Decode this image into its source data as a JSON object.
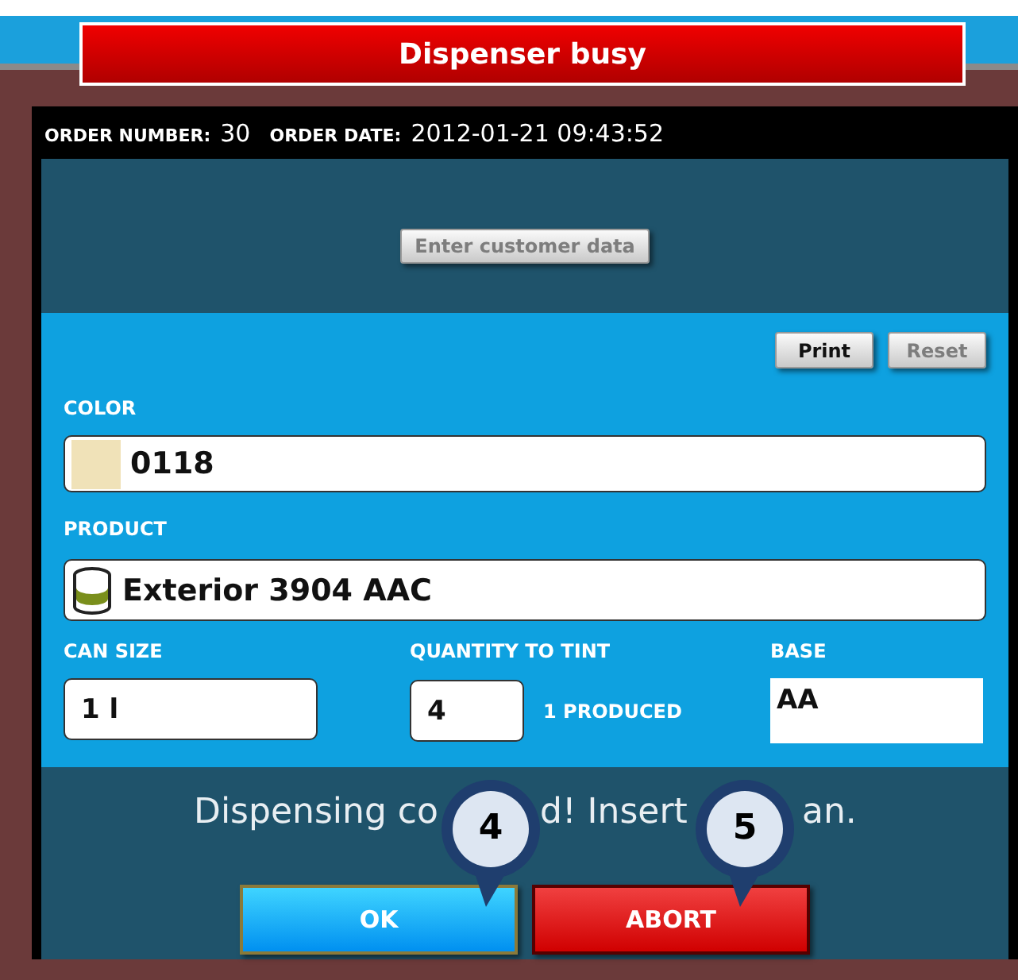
{
  "title": "Dispenser busy",
  "order": {
    "number_label": "ORDER NUMBER:",
    "number": "30",
    "date_label": "ORDER DATE:",
    "date": "2012-01-21 09:43:52"
  },
  "customer_button": {
    "label": "Enter customer data",
    "disabled": true
  },
  "toolbar": [
    {
      "label": "Print",
      "disabled": false
    },
    {
      "label": "Reset",
      "disabled": true
    }
  ],
  "color": {
    "label": "COLOR",
    "value": "0118",
    "color": "#f0e2b8"
  },
  "product": {
    "label": "PRODUCT",
    "value": "Exterior 3904 AAC"
  },
  "can_size": {
    "label": "CAN SIZE",
    "value": "1 l"
  },
  "quantity": {
    "label": "QUANTITY TO TINT",
    "value": "4",
    "produced": "1 PRODUCED"
  },
  "base": {
    "label": "BASE",
    "value": "AA"
  },
  "message_parts": [
    "Dispensing co",
    "d! Insert",
    "an."
  ],
  "buttons": [
    {
      "label": "OK",
      "kind": "ok"
    },
    {
      "label": "ABORT",
      "kind": "abort"
    }
  ],
  "callouts": [
    {
      "number": "4"
    },
    {
      "number": "5"
    }
  ]
}
